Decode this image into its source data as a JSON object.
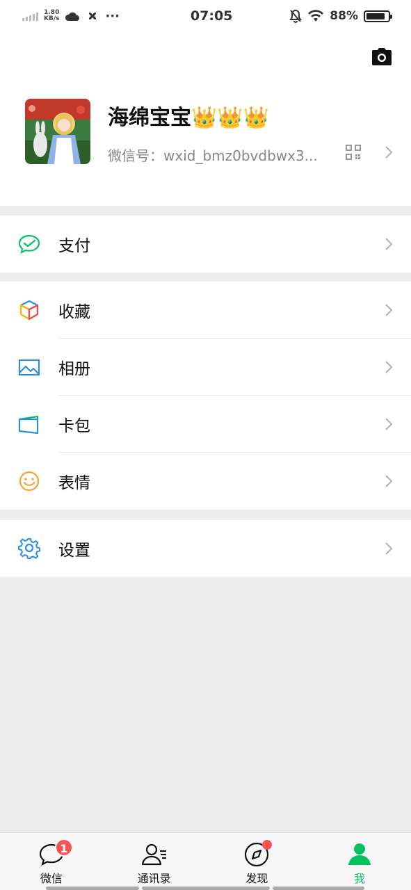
{
  "status_bar": {
    "net_speed_value": "1.80",
    "net_speed_unit": "KB/s",
    "extra": "···",
    "time": "07:05",
    "battery": "88%",
    "battery_level": 0.88
  },
  "profile": {
    "nickname": "海绵宝宝👑👑👑",
    "wechat_id": "微信号：wxid_bmz0bvdbwx3..."
  },
  "menu": {
    "pay": "支付",
    "favorites": "收藏",
    "album": "相册",
    "cards": "卡包",
    "stickers": "表情",
    "settings": "设置"
  },
  "tabs": [
    {
      "label": "微信",
      "badge": "1"
    },
    {
      "label": "通讯录"
    },
    {
      "label": "发现"
    },
    {
      "label": "我"
    }
  ],
  "colors": {
    "accent": "#07c160",
    "badge": "#fa5151",
    "background": "#ededed"
  }
}
